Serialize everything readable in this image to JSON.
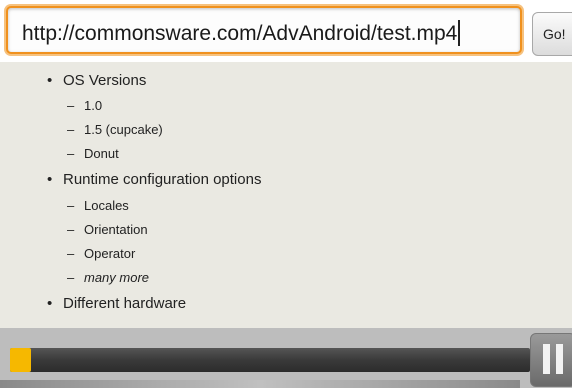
{
  "url_bar": {
    "value": "http://commonsware.com/AdvAndroid/test.mp4",
    "go_label": "Go!"
  },
  "slide": {
    "bullets": [
      {
        "text": "OS Versions",
        "subs": [
          "1.0",
          "1.5 (cupcake)",
          "Donut"
        ]
      },
      {
        "text": "Runtime configuration options",
        "subs": [
          "Locales",
          "Orientation",
          "Operator",
          "many more"
        ]
      },
      {
        "text": "Different hardware",
        "subs": []
      }
    ],
    "bullet_glyph": "•",
    "dash_glyph": "–"
  },
  "player": {
    "progress_fraction": 0.04,
    "progress_color": "#f6b800",
    "pause_icon": "pause-icon"
  },
  "colors": {
    "accent": "#f0911e",
    "background": "#e9e8e1"
  }
}
